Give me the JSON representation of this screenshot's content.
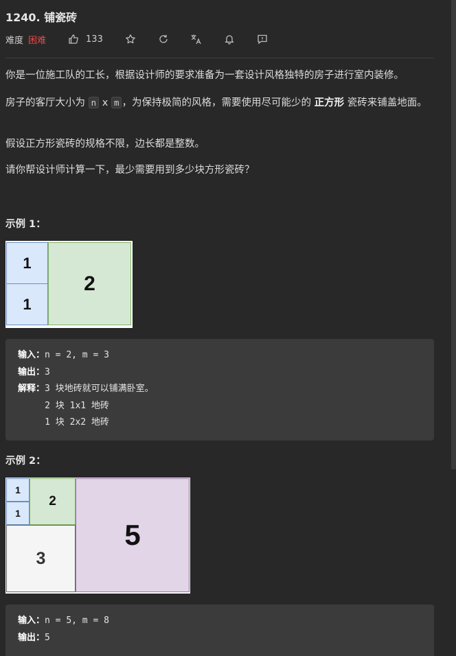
{
  "problem": {
    "title": "1240. 铺瓷砖",
    "difficulty_label": "难度",
    "difficulty_value": "困难",
    "likes": "133"
  },
  "icons": [
    "thumbs-up-icon",
    "star-icon",
    "share-icon",
    "translate-icon",
    "bell-icon",
    "feedback-icon"
  ],
  "colors": {
    "difficulty": "#ef4743",
    "background": "#282828",
    "code_bg": "#3b3b3b"
  },
  "description": {
    "p1": "你是一位施工队的工长，根据设计师的要求准备为一套设计风格独特的房子进行室内装修。",
    "p2_a": "房子的客厅大小为 ",
    "p2_code_n": "n",
    "p2_x": " x ",
    "p2_code_m": "m",
    "p2_b": "，为保持极简的风格，需要使用尽可能少的 ",
    "p2_bold": "正方形",
    "p2_c": " 瓷砖来铺盖地面。",
    "p3": "假设正方形瓷砖的规格不限，边长都是整数。",
    "p4": "请你帮设计师计算一下，最少需要用到多少块方形瓷砖？"
  },
  "example1": {
    "heading": "示例 1：",
    "tiles": [
      "1",
      "1",
      "2"
    ],
    "input_label": "输入：",
    "input_value": "n = 2, m = 3",
    "output_label": "输出：",
    "output_value": "3",
    "explain_label": "解释：",
    "explain_value": "3 块地砖就可以铺满卧室。",
    "explain_line2": "     2 块 1x1 地砖",
    "explain_line3": "     1 块 2x2 地砖"
  },
  "example2": {
    "heading": "示例 2：",
    "tiles": [
      "1",
      "1",
      "2",
      "3",
      "5"
    ],
    "input_label": "输入：",
    "input_value": "n = 5, m = 8",
    "output_label": "输出：",
    "output_value": "5"
  }
}
